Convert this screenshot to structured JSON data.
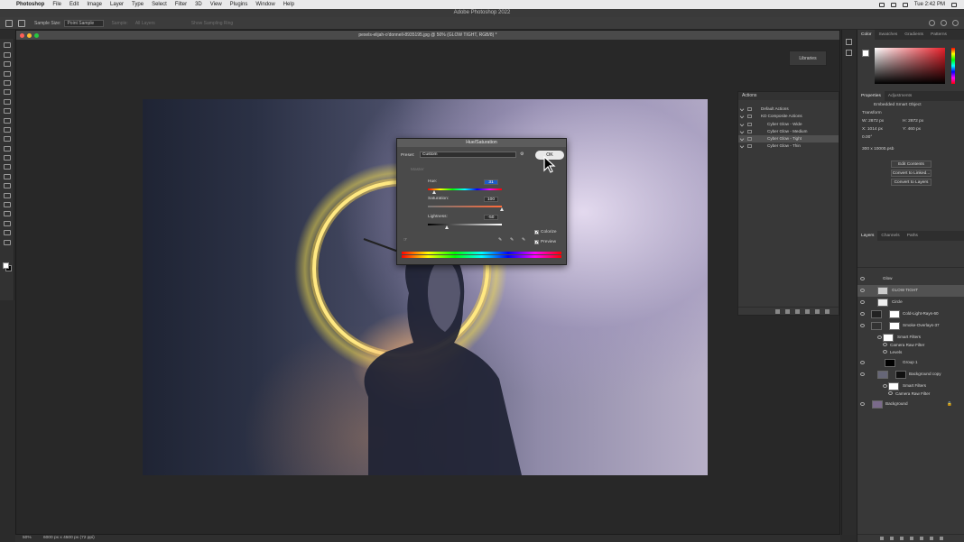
{
  "menubar": {
    "app_name": "Photoshop",
    "items": [
      "File",
      "Edit",
      "Image",
      "Layer",
      "Type",
      "Select",
      "Filter",
      "3D",
      "View",
      "Plugins",
      "Window",
      "Help"
    ],
    "clock": "Tue 2:42 PM"
  },
  "window_title": "Adobe Photoshop 2022",
  "options_bar": {
    "sample_size_label": "Sample Size:",
    "sample_size_value": "Point Sample",
    "sample_label": "Sample:",
    "sample_value": "All Layers",
    "show_ring_label": "Show Sampling Ring"
  },
  "document": {
    "tab_title": "pexels-elijah-o'donnell-8935195.jpg @ 50% (GLOW TIGHT, RGB/8) *",
    "zoom": "50%",
    "doc_info": "6000 px x 4500 px (72 ppi)"
  },
  "libraries_label": "Libraries",
  "actions_panel": {
    "title": "Actions",
    "rows": [
      {
        "label": "Default Actions",
        "selected": false
      },
      {
        "label": "KD Composite Actions",
        "selected": false
      },
      {
        "label": "Cyber Glow - Wide",
        "selected": false
      },
      {
        "label": "Cyber Glow - Medium",
        "selected": false
      },
      {
        "label": "Cyber Glow - Tight",
        "selected": true
      },
      {
        "label": "Cyber Glow - Thin",
        "selected": false
      }
    ]
  },
  "dialog": {
    "title": "Hue/Saturation",
    "preset_label": "Preset:",
    "preset_value": "Custom",
    "master_label": "Master",
    "hue_label": "Hue:",
    "hue_value": "31",
    "saturation_label": "Saturation:",
    "saturation_value": "100",
    "lightness_label": "Lightness:",
    "lightness_value": "-50",
    "ok_label": "OK",
    "colorize_label": "Colorize",
    "colorize_checked": true,
    "preview_label": "Preview",
    "preview_checked": true,
    "hue_level": 0.043,
    "saturation_level": 1.0,
    "lightness_level": 0.25
  },
  "right_dock": {
    "color_tabs": [
      "Color",
      "Swatches",
      "Gradients",
      "Patterns"
    ],
    "prop_tabs": [
      "Properties",
      "Adjustments"
    ],
    "prop_type": "Embedded Smart Object",
    "transform_label": "Transform",
    "w_label": "W:",
    "w_value": "2872 px",
    "h_label": "H:",
    "h_value": "2872 px",
    "x_label": "X:",
    "x_value": "1014 px",
    "y_label": "Y:",
    "y_value": "460 px",
    "angle_value": "0.00°",
    "file_size": "300 x 10000.psb",
    "edit_contents": "Edit Contents",
    "convert_linked": "Convert to Linked...",
    "convert_layers": "Convert to Layers",
    "layer_tabs": [
      "Layers",
      "Channels",
      "Paths"
    ],
    "layers": [
      {
        "name": "Glow",
        "selected": false
      },
      {
        "name": "GLOW TIGHT",
        "selected": true
      },
      {
        "name": "Circle",
        "selected": false
      },
      {
        "name": "Cold-Light-Rays-60",
        "selected": false
      },
      {
        "name": "Smoke-Overlays-37",
        "selected": false
      },
      {
        "name": "Smart Filters",
        "selected": false
      },
      {
        "name": "Camera Raw Filter",
        "selected": false
      },
      {
        "name": "Levels",
        "selected": false
      },
      {
        "name": "Group 1",
        "selected": false
      },
      {
        "name": "Background copy",
        "selected": false
      },
      {
        "name": "Smart Filters",
        "selected": false
      },
      {
        "name": "Camera Raw Filter",
        "selected": false
      },
      {
        "name": "Background",
        "selected": false
      }
    ]
  }
}
